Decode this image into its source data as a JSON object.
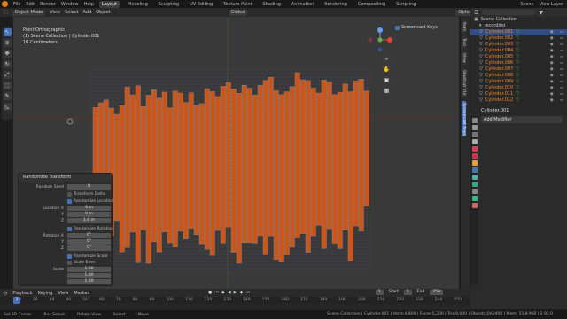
{
  "topbar": {
    "menus": [
      "File",
      "Edit",
      "Render",
      "Window",
      "Help"
    ],
    "workspaces": [
      "Layout",
      "Modeling",
      "Sculpting",
      "UV Editing",
      "Texture Paint",
      "Shading",
      "Animation",
      "Rendering",
      "Compositing",
      "Scripting"
    ],
    "active_workspace": "Layout",
    "scene": "Scene",
    "view_layer": "View Layer"
  },
  "header3d": {
    "mode": "Object Mode",
    "menus": [
      "View",
      "Select",
      "Add",
      "Object"
    ],
    "orientation": "Global",
    "options": "Options"
  },
  "viewport_info": {
    "line1": "Point Orthographic",
    "line2": "(1) Scene Collection | Cylinder.001",
    "line3": "10 Centimeters"
  },
  "screencast": {
    "label": "Screencast Keys"
  },
  "nav_tabs": [
    "Item",
    "Tool",
    "View",
    "Shortcut VUr",
    "Screencast Keys"
  ],
  "outliner": {
    "root": "Scene Collection",
    "collection": "recording",
    "objects": [
      "Cylinder.001",
      "Cylinder.002",
      "Cylinder.003",
      "Cylinder.004",
      "Cylinder.005",
      "Cylinder.006",
      "Cylinder.007",
      "Cylinder.008",
      "Cylinder.009",
      "Cylinder.010",
      "Cylinder.011",
      "Cylinder.012"
    ]
  },
  "properties": {
    "object_name": "Cylinder.001",
    "add_modifier": "Add Modifier"
  },
  "operator_panel": {
    "title": "Randomize Transform",
    "random_seed_label": "Random Seed",
    "random_seed": "0",
    "transform_delta": "Transform Delta",
    "randomize_location": "Randomize Location",
    "location_x_label": "Location X",
    "location_x": "0 m",
    "y_label": "Y",
    "location_y": "0 m",
    "z_label": "Z",
    "location_z": "1.6 m",
    "randomize_rotation": "Randomize Rotation",
    "rotation_x_label": "Rotation X",
    "rotation_x": "0°",
    "rotation_y": "0°",
    "rotation_z": "0°",
    "randomize_scale": "Randomize Scale",
    "scale_even": "Scale Even",
    "scale_label": "Scale",
    "scale_x": "1.00",
    "scale_y": "1.00",
    "scale_z": "1.00"
  },
  "timeline": {
    "menus": [
      "Playback",
      "Keying",
      "View",
      "Marker"
    ],
    "current_frame": "1",
    "start_label": "Start",
    "start": "1",
    "end_label": "End",
    "end": "250",
    "ruler": [
      "10",
      "20",
      "30",
      "40",
      "50",
      "60",
      "70",
      "80",
      "90",
      "100",
      "110",
      "120",
      "130",
      "140",
      "150",
      "160",
      "170",
      "180",
      "190",
      "200",
      "210",
      "220",
      "230",
      "240",
      "250"
    ]
  },
  "statusbar": {
    "items": [
      "Set 3D Cursor",
      "Box Select",
      "Rotate View",
      "Select",
      "Move"
    ],
    "stats": "Scene Collection | Cylinder.001 | Verts:4,800 | Faces:5,200 | Tris:8,000 | Objects:0/0/400 | Mem: 51.8 MiB | 2.92.0"
  },
  "colors": {
    "accent": "#4772b3",
    "selected_object": "#f08a2a",
    "mesh_fill": "#e65a12",
    "viewport_bg": "#393939"
  }
}
